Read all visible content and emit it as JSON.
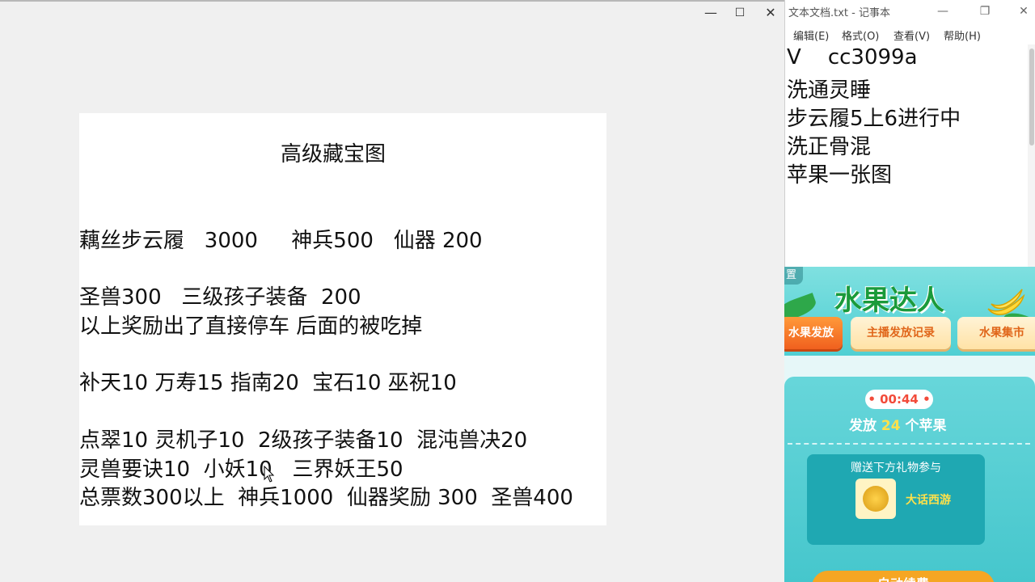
{
  "left_window": {
    "controls": {
      "minimize": "—",
      "maximize": "☐",
      "close": "✕"
    },
    "document": {
      "title": "高级藏宝图",
      "lines": [
        "藕丝步云履   3000     神兵500   仙器 200",
        "圣兽300   三级孩子装备  200",
        "以上奖励出了直接停车 后面的被吃掉",
        "补天10 万寿15 指南20  宝石10 巫祝10",
        "点翠10 灵机子10  2级孩子装备10  混沌兽决20",
        "灵兽要诀10  小妖10   三界妖王50",
        "总票数300以上  神兵1000  仙器奖励 300  圣兽400"
      ]
    }
  },
  "notepad": {
    "title": "文本文档.txt - 记事本",
    "controls": {
      "minimize": "—",
      "maximize": "❐",
      "close": "✕"
    },
    "menu": [
      "编辑(E)",
      "格式(O)",
      "查看(V)",
      "帮助(H)"
    ],
    "lines": [
      "V    cc3099a",
      "洗通灵睡",
      "步云履5上6进行中",
      "洗正骨混",
      "苹果一张图"
    ]
  },
  "fruit_app": {
    "corner_tag": "置",
    "title": "水果达人",
    "tabs": [
      "水果发放",
      "主播发放记录",
      "水果集市"
    ],
    "timer": "• 00:44 •",
    "release_prefix": "发放 ",
    "release_count": "24",
    "release_suffix": " 个苹果",
    "gift_heading": "赠送下方礼物参与",
    "gift_name": "大话西游",
    "bottom_button": "自动续费",
    "colors": {
      "accent_orange": "#f0601e",
      "title_green": "#1a9a3a",
      "panel_teal": "#45c6cc",
      "count_yellow": "#ffe14a",
      "timer_red": "#f24b3a"
    }
  }
}
